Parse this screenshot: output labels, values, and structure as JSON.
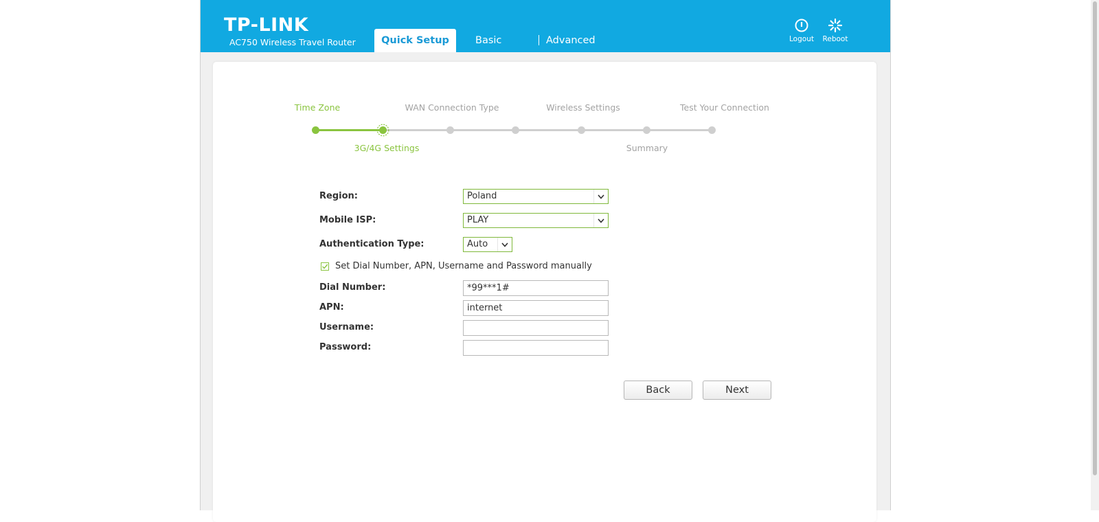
{
  "header": {
    "logo": "TP-LINK",
    "model": "AC750 Wireless Travel Router",
    "tabs": [
      "Quick Setup",
      "Basic",
      "Advanced"
    ],
    "active_tab": "Quick Setup",
    "logout_label": "Logout",
    "reboot_label": "Reboot"
  },
  "wizard": {
    "steps_top": [
      "Time Zone",
      "WAN Connection Type",
      "Wireless Settings",
      "Test Your Connection"
    ],
    "steps_bottom": [
      "3G/4G Settings",
      "Summary"
    ],
    "current_step": "3G/4G Settings"
  },
  "form": {
    "region_label": "Region:",
    "region_value": "Poland",
    "isp_label": "Mobile ISP:",
    "isp_value": "PLAY",
    "auth_label": "Authentication Type:",
    "auth_value": "Auto",
    "manual_label": "Set Dial Number, APN, Username and Password manually",
    "manual_checked": true,
    "dial_label": "Dial Number:",
    "dial_value": "*99***1#",
    "apn_label": "APN:",
    "apn_value": "internet",
    "username_label": "Username:",
    "username_value": "",
    "password_label": "Password:",
    "password_value": ""
  },
  "buttons": {
    "back": "Back",
    "next": "Next"
  },
  "colors": {
    "header_blue": "#11a9e1",
    "progress_green": "#8ac43f",
    "pending_gray": "#cfcfcf"
  }
}
